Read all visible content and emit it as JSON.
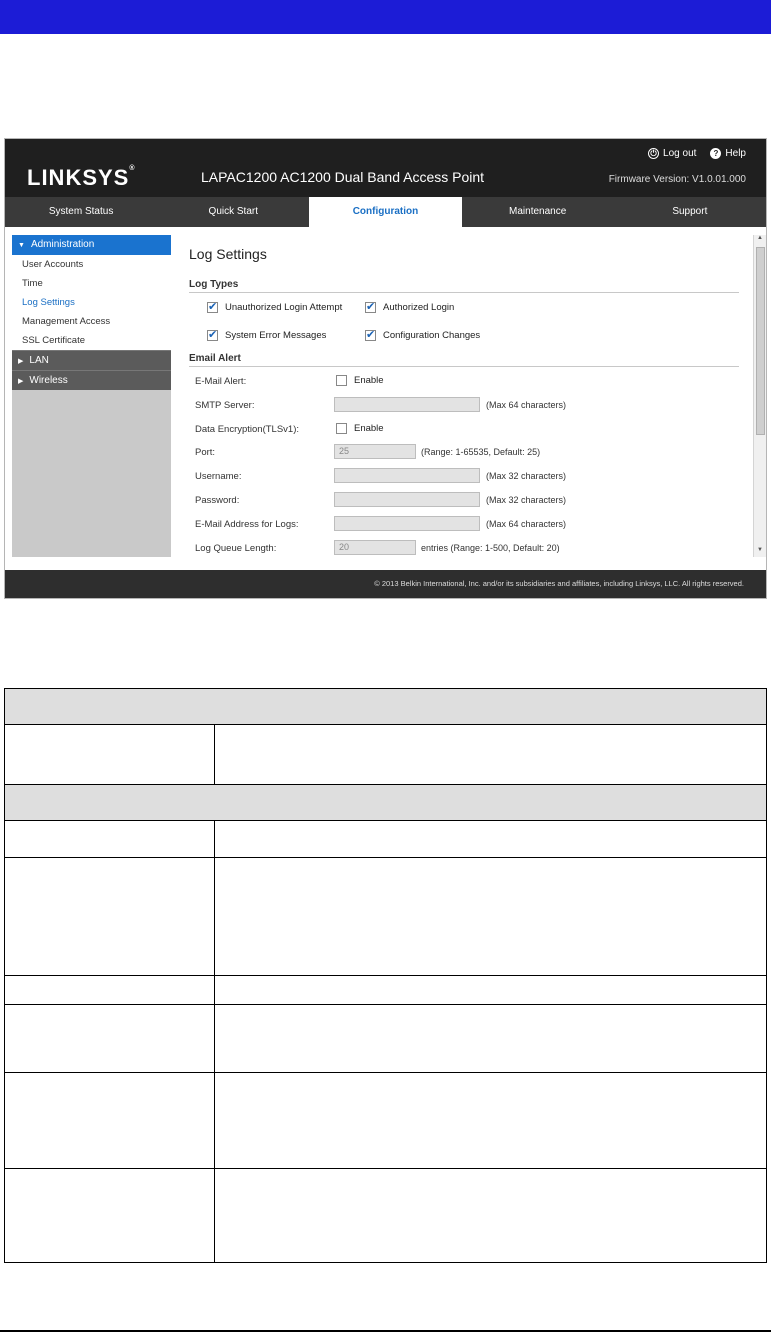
{
  "header": {
    "logo": "LINKSYS",
    "logo_mark": "®",
    "product": "LAPAC1200 AC1200 Dual Band Access Point",
    "logout": "Log out",
    "help": "Help",
    "firmware": "Firmware Version: V1.0.01.000"
  },
  "nav": {
    "tabs": [
      "System Status",
      "Quick Start",
      "Configuration",
      "Maintenance",
      "Support"
    ],
    "active": "Configuration"
  },
  "sidebar": {
    "administration": "Administration",
    "items": [
      "User Accounts",
      "Time",
      "Log Settings",
      "Management Access",
      "SSL Certificate"
    ],
    "current": "Log Settings",
    "lan": "LAN",
    "wireless": "Wireless"
  },
  "main": {
    "title": "Log Settings",
    "log_types": {
      "heading": "Log Types",
      "unauth": "Unauthorized Login Attempt",
      "auth": "Authorized Login",
      "syserr": "System Error Messages",
      "config": "Configuration Changes"
    },
    "email": {
      "heading": "Email Alert",
      "alert_label": "E-Mail Alert:",
      "enable": "Enable",
      "smtp_label": "SMTP Server:",
      "smtp_note": "(Max 64 characters)",
      "enc_label": "Data Encryption(TLSv1):",
      "port_label": "Port:",
      "port_value": "25",
      "port_note": "(Range: 1-65535, Default: 25)",
      "user_label": "Username:",
      "user_note": "(Max 32 characters)",
      "pass_label": "Password:",
      "pass_note": "(Max 32 characters)",
      "addr_label": "E-Mail Address for Logs:",
      "addr_note": "(Max 64 characters)",
      "queue_label": "Log Queue Length:",
      "queue_value": "20",
      "queue_note": "entries (Range: 1-500, Default: 20)"
    }
  },
  "footer": "© 2013 Belkin International, Inc. and/or its subsidiaries and affiliates, including Linksys, LLC. All rights reserved."
}
